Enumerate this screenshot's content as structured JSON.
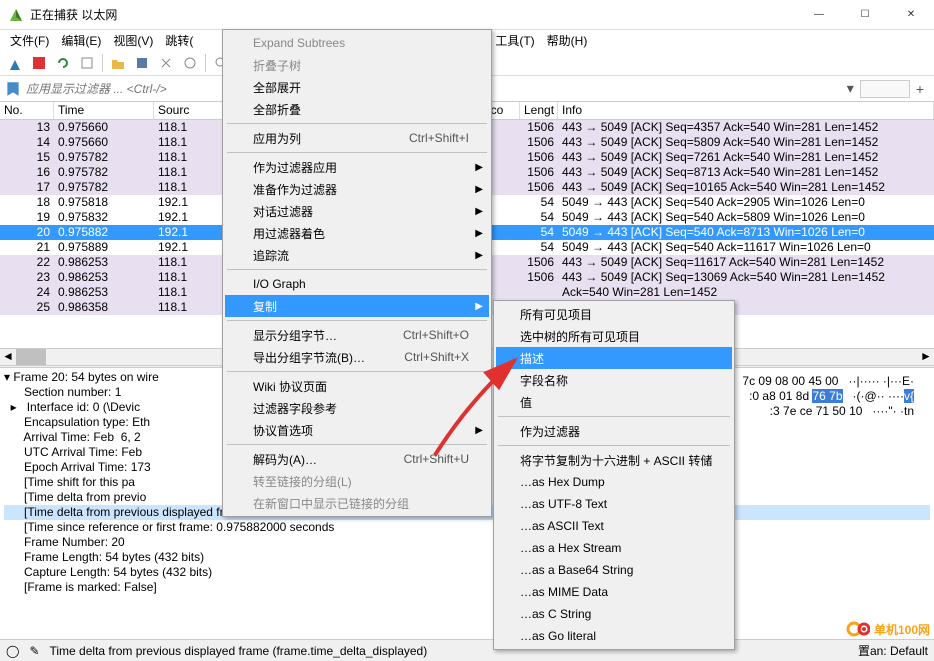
{
  "window": {
    "title": "正在捕获 以太网",
    "minimize": "—",
    "maximize": "☐",
    "close": "✕"
  },
  "menubar": [
    "文件(F)",
    "编辑(E)",
    "视图(V)",
    "跳转(",
    "",
    "工具(T)",
    "帮助(H)"
  ],
  "filter": {
    "placeholder": "应用显示过滤器 ... <Ctrl-/>"
  },
  "columns": [
    "No.",
    "Time",
    "Sourc",
    "oco",
    "Lengt",
    "Info"
  ],
  "packets": [
    {
      "no": "13",
      "time": "0.975660",
      "src": "118.1",
      "len": "1506",
      "info": "443 → 5049 [ACK] Seq=4357 Ack=540 Win=281 Len=1452",
      "cls": "purple"
    },
    {
      "no": "14",
      "time": "0.975660",
      "src": "118.1",
      "len": "1506",
      "info": "443 → 5049 [ACK] Seq=5809 Ack=540 Win=281 Len=1452",
      "cls": "purple"
    },
    {
      "no": "15",
      "time": "0.975782",
      "src": "118.1",
      "len": "1506",
      "info": "443 → 5049 [ACK] Seq=7261 Ack=540 Win=281 Len=1452",
      "cls": "purple"
    },
    {
      "no": "16",
      "time": "0.975782",
      "src": "118.1",
      "len": "1506",
      "info": "443 → 5049 [ACK] Seq=8713 Ack=540 Win=281 Len=1452",
      "cls": "purple"
    },
    {
      "no": "17",
      "time": "0.975782",
      "src": "118.1",
      "len": "1506",
      "info": "443 → 5049 [ACK] Seq=10165 Ack=540 Win=281 Len=1452",
      "cls": "purple"
    },
    {
      "no": "18",
      "time": "0.975818",
      "src": "192.1",
      "len": "54",
      "info": "5049 → 443 [ACK] Seq=540 Ack=2905 Win=1026 Len=0",
      "cls": ""
    },
    {
      "no": "19",
      "time": "0.975832",
      "src": "192.1",
      "len": "54",
      "info": "5049 → 443 [ACK] Seq=540 Ack=5809 Win=1026 Len=0",
      "cls": ""
    },
    {
      "no": "20",
      "time": "0.975882",
      "src": "192.1",
      "len": "54",
      "info": "5049 → 443 [ACK] Seq=540 Ack=8713 Win=1026 Len=0",
      "cls": "selected"
    },
    {
      "no": "21",
      "time": "0.975889",
      "src": "192.1",
      "len": "54",
      "info": "5049 → 443 [ACK] Seq=540 Ack=11617 Win=1026 Len=0",
      "cls": ""
    },
    {
      "no": "22",
      "time": "0.986253",
      "src": "118.1",
      "len": "1506",
      "info": "443 → 5049 [ACK] Seq=11617 Ack=540 Win=281 Len=1452",
      "cls": "purple"
    },
    {
      "no": "23",
      "time": "0.986253",
      "src": "118.1",
      "len": "1506",
      "info": "443 → 5049 [ACK] Seq=13069 Ack=540 Win=281 Len=1452",
      "cls": "purple"
    },
    {
      "no": "24",
      "time": "0.986253",
      "src": "118.1",
      "len": "",
      "info": "                        Ack=540 Win=281 Len=1452",
      "cls": "purple"
    },
    {
      "no": "25",
      "time": "0.986358",
      "src": "118.1",
      "len": "",
      "info": "",
      "cls": "purple"
    }
  ],
  "details": [
    "Frame 20: 54 bytes on wire",
    "  Section number: 1",
    "  Interface id: 0 (\\Devic",
    "  Encapsulation type: Eth",
    "  Arrival Time: Feb  6, 2",
    "  UTC Arrival Time: Feb  ",
    "  Epoch Arrival Time: 173",
    "  [Time shift for this pa",
    "  [Time delta from previo",
    "  [Time delta from previous displayed frame: 0.000050000 se",
    "  [Time since reference or first frame: 0.975882000 seconds",
    "  Frame Number: 20",
    "  Frame Length: 54 bytes (432 bits)",
    "  Capture Length: 54 bytes (432 bits)",
    "  [Frame is marked: False]"
  ],
  "hexlines": [
    {
      "pre": "7c 09 08 00 45 00",
      "asc": "··|····· ·|···E·",
      "hl": ""
    },
    {
      "pre": ":0 a8 01 8d ",
      "mid": "76 7b",
      "asc": "·(·@·· ····",
      "hl": "v{"
    },
    {
      "pre": ":3 7e ce 71 50 10",
      "asc": "····\"· ·",
      "hl": "tn"
    }
  ],
  "statusbar": {
    "text": "Time delta from previous displayed frame (frame.time_delta_displayed)",
    "profile": "置an: Default"
  },
  "contextmenu": {
    "items": [
      {
        "label": "Expand Subtrees",
        "type": "item",
        "disabled": true
      },
      {
        "label": "折叠子树",
        "type": "item",
        "disabled": true
      },
      {
        "label": "全部展开",
        "type": "item"
      },
      {
        "label": "全部折叠",
        "type": "item"
      },
      {
        "type": "sep"
      },
      {
        "label": "应用为列",
        "shortcut": "Ctrl+Shift+I",
        "type": "item"
      },
      {
        "type": "sep"
      },
      {
        "label": "作为过滤器应用",
        "arrow": true,
        "type": "item"
      },
      {
        "label": "准备作为过滤器",
        "arrow": true,
        "type": "item"
      },
      {
        "label": "对话过滤器",
        "arrow": true,
        "type": "item"
      },
      {
        "label": "用过滤器着色",
        "arrow": true,
        "type": "item"
      },
      {
        "label": "追踪流",
        "arrow": true,
        "type": "item"
      },
      {
        "type": "sep"
      },
      {
        "label": "I/O Graph",
        "type": "item"
      },
      {
        "label": "复制",
        "arrow": true,
        "type": "item",
        "highlighted": true
      },
      {
        "type": "sep"
      },
      {
        "label": "显示分组字节…",
        "shortcut": "Ctrl+Shift+O",
        "type": "item"
      },
      {
        "label": "导出分组字节流(B)…",
        "shortcut": "Ctrl+Shift+X",
        "type": "item"
      },
      {
        "type": "sep"
      },
      {
        "label": "Wiki 协议页面",
        "type": "item"
      },
      {
        "label": "过滤器字段参考",
        "type": "item"
      },
      {
        "label": "协议首选项",
        "arrow": true,
        "type": "item"
      },
      {
        "type": "sep"
      },
      {
        "label": "解码为(A)…",
        "shortcut": "Ctrl+Shift+U",
        "type": "item"
      },
      {
        "label": "转至链接的分组(L)",
        "type": "item",
        "disabled": true
      },
      {
        "label": "在新窗口中显示已链接的分组",
        "type": "item",
        "disabled": true
      }
    ]
  },
  "submenu": {
    "items": [
      {
        "label": "所有可见项目",
        "type": "item"
      },
      {
        "label": "选中树的所有可见项目",
        "type": "item"
      },
      {
        "label": "描述",
        "type": "item",
        "highlighted": true
      },
      {
        "label": "字段名称",
        "type": "item"
      },
      {
        "label": "值",
        "type": "item"
      },
      {
        "type": "sep"
      },
      {
        "label": "作为过滤器",
        "type": "item"
      },
      {
        "type": "sep"
      },
      {
        "label": "将字节复制为十六进制 + ASCII 转储",
        "type": "item"
      },
      {
        "label": "…as Hex Dump",
        "type": "item"
      },
      {
        "label": "…as UTF-8 Text",
        "type": "item"
      },
      {
        "label": "…as ASCII Text",
        "type": "item"
      },
      {
        "label": "…as a Hex Stream",
        "type": "item"
      },
      {
        "label": "…as a Base64 String",
        "type": "item"
      },
      {
        "label": "…as MIME Data",
        "type": "item"
      },
      {
        "label": "…as C String",
        "type": "item"
      },
      {
        "label": "…as Go literal",
        "type": "item"
      }
    ]
  },
  "watermark": "单机100网"
}
